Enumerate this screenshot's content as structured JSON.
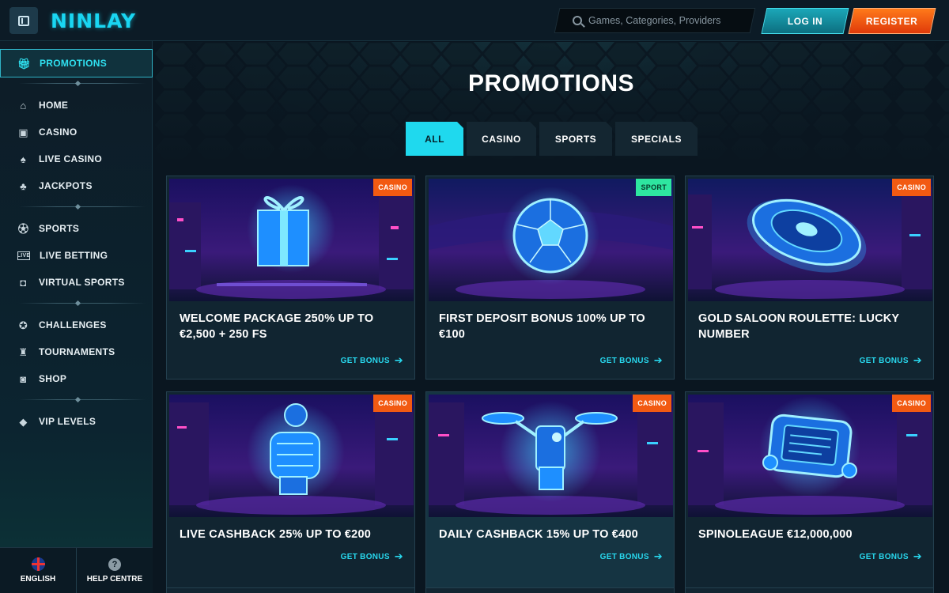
{
  "header": {
    "logo": "NINLAY",
    "search_placeholder": "Games, Categories, Providers",
    "login_label": "LOG IN",
    "register_label": "REGISTER"
  },
  "sidebar": {
    "promotions": "PROMOTIONS",
    "items": [
      {
        "label": "HOME",
        "icon": "home-icon"
      },
      {
        "label": "CASINO",
        "icon": "slot-machine-icon"
      },
      {
        "label": "LIVE CASINO",
        "icon": "cards-icon"
      },
      {
        "label": "JACKPOTS",
        "icon": "clover-icon"
      },
      {
        "label": "SPORTS",
        "icon": "soccer-ball-icon"
      },
      {
        "label": "LIVE BETTING",
        "icon": "live-icon"
      },
      {
        "label": "VIRTUAL SPORTS",
        "icon": "gamepad-icon"
      },
      {
        "label": "CHALLENGES",
        "icon": "medal-icon"
      },
      {
        "label": "TOURNAMENTS",
        "icon": "trophy-icon"
      },
      {
        "label": "SHOP",
        "icon": "shopping-bag-icon"
      },
      {
        "label": "VIP LEVELS",
        "icon": "diamond-icon"
      }
    ],
    "language": "ENGLISH",
    "help": "HELP CENTRE"
  },
  "main": {
    "title": "PROMOTIONS",
    "tabs": [
      "ALL",
      "CASINO",
      "SPORTS",
      "SPECIALS"
    ],
    "active_tab": "ALL",
    "cards": [
      {
        "title": "WELCOME PACKAGE 250% UP TO €2,500 + 250 FS",
        "badge": "CASINO",
        "cta": "GET BONUS",
        "art": "gift"
      },
      {
        "title": "FIRST DEPOSIT BONUS 100% UP TO €100",
        "badge": "SPORT",
        "cta": "GET BONUS",
        "art": "ball"
      },
      {
        "title": "GOLD SALOON ROULETTE: LUCKY NUMBER",
        "badge": "CASINO",
        "cta": "GET BONUS",
        "art": "roulette"
      },
      {
        "title": "LIVE CASHBACK 25% UP TO €200",
        "badge": "CASINO",
        "cta": "GET BONUS",
        "art": "hand"
      },
      {
        "title": "DAILY CASHBACK 15% UP TO €400",
        "badge": "CASINO",
        "cta": "GET BONUS",
        "art": "drone"
      },
      {
        "title": "SPINOLEAGUE €12,000,000",
        "badge": "CASINO",
        "cta": "GET BONUS",
        "art": "device"
      }
    ]
  },
  "colors": {
    "accent": "#1fd9ee",
    "register": "#f25a12",
    "sport_badge": "#2ee6a0",
    "background": "#0a1620"
  }
}
